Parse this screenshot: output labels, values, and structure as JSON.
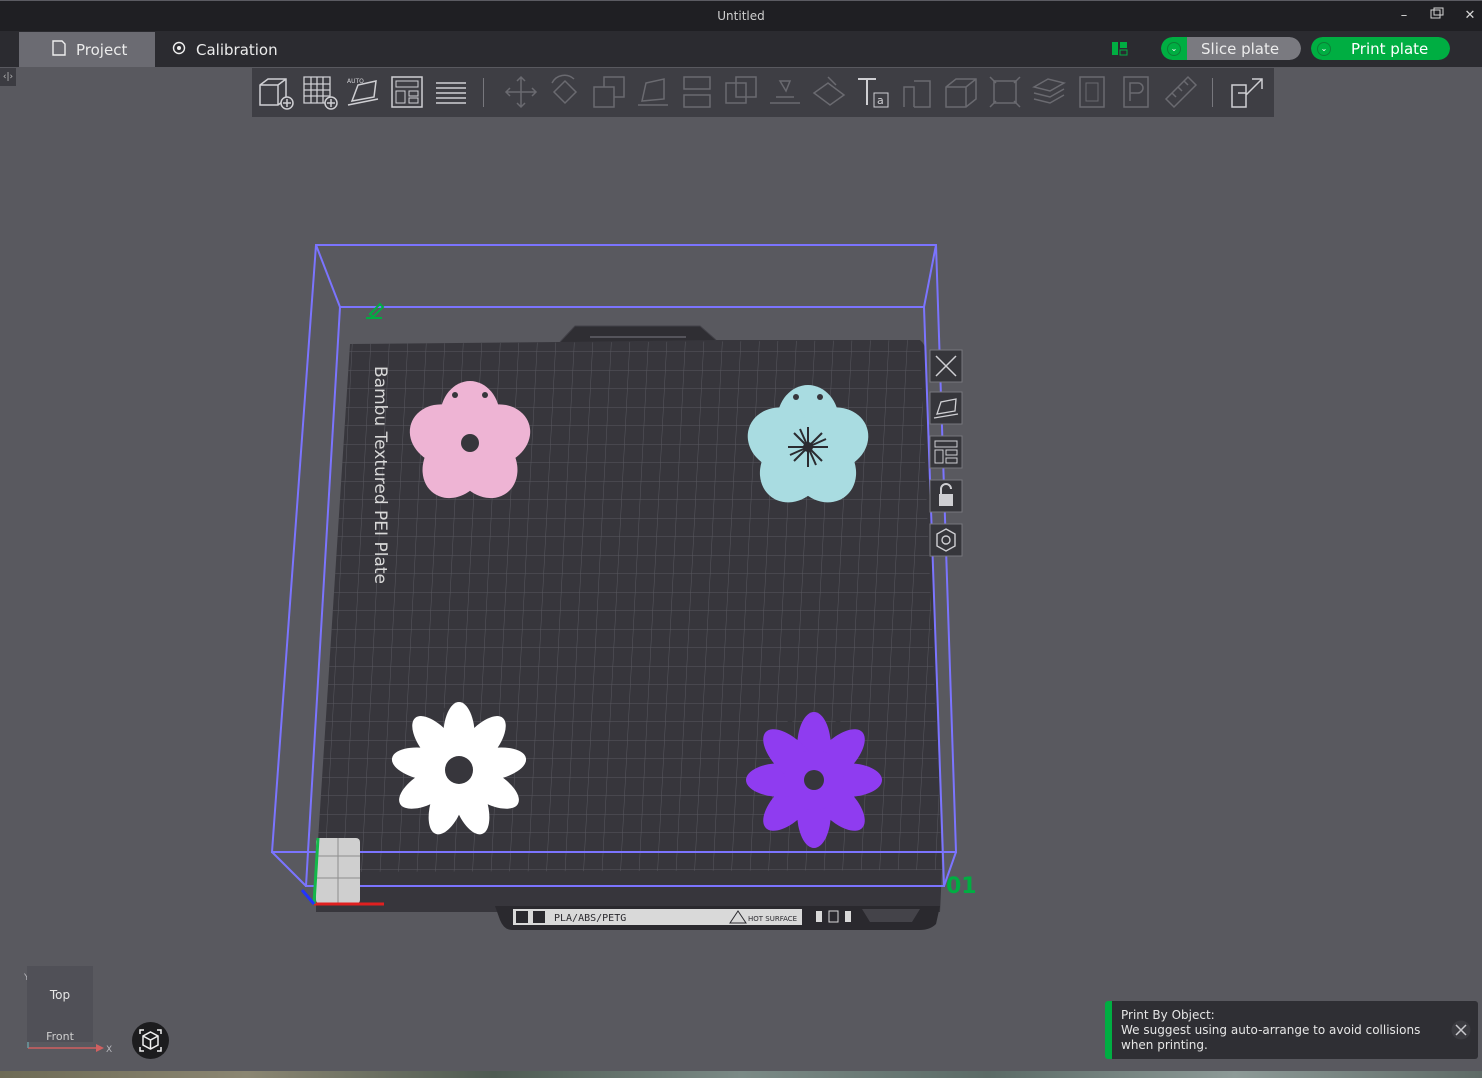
{
  "window": {
    "title": "Untitled"
  },
  "tabs": [
    {
      "label": "Project",
      "active": true
    },
    {
      "label": "Calibration",
      "active": false
    }
  ],
  "actions": {
    "slice_label": "Slice plate",
    "print_label": "Print plate"
  },
  "toolbar_icons": [
    "add-object-icon",
    "add-plate-icon",
    "auto-orient-icon",
    "arrange-icon",
    "split-to-parts-icon",
    "move-icon",
    "rotate-icon",
    "scale-icon",
    "lay-on-face-icon",
    "cut-icon",
    "mesh-boolean-icon",
    "support-paint-icon",
    "seam-paint-icon",
    "text-icon",
    "assembly-icon",
    "variable-layer-icon",
    "measure-icon",
    "layers-icon",
    "emboss-icon",
    "svg-icon",
    "ruler-icon",
    "assembly-view-icon"
  ],
  "plate": {
    "label": "Bambu Textured PEI Plate",
    "material_label": "PLA/ABS/PETG",
    "surface_label": "HOT SURFACE",
    "plate_number": "01"
  },
  "objects": [
    {
      "name": "pink-flower",
      "color": "#eeb4d4"
    },
    {
      "name": "cyan-flower",
      "color": "#a9dce1"
    },
    {
      "name": "white-flower",
      "color": "#ffffff"
    },
    {
      "name": "purple-flower",
      "color": "#8f3cf0"
    }
  ],
  "view": {
    "top_label": "Top",
    "front_label": "Front",
    "x_axis": "X",
    "y_axis": "Y"
  },
  "notification": {
    "title": "Print By Object:",
    "message": "We suggest using auto-arrange to avoid collisions when printing."
  },
  "colors": {
    "accent": "#00ae42",
    "bbox": "#7b74ff",
    "plate": "#37363c"
  }
}
